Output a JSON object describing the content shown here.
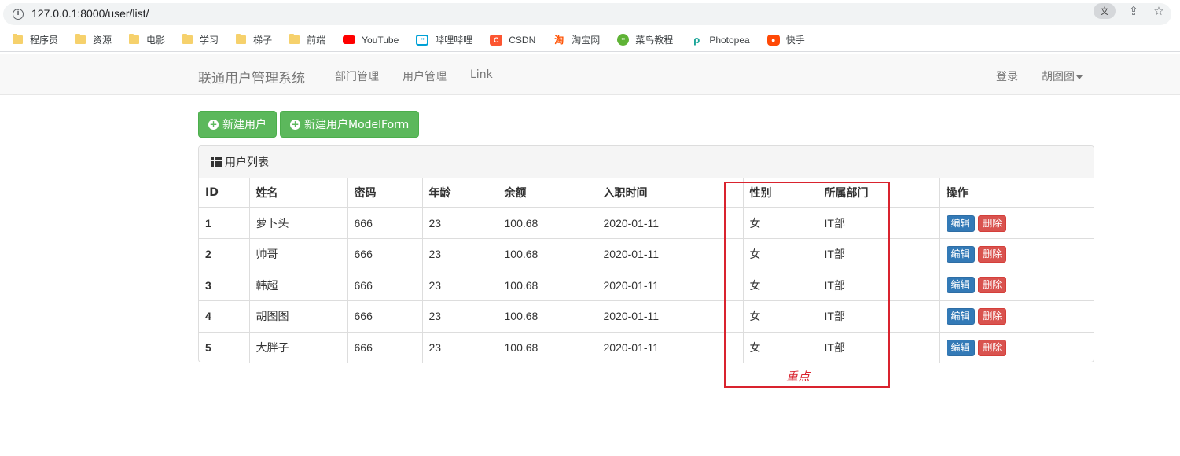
{
  "browser": {
    "url": "127.0.0.1:8000/user/list/",
    "bookmarks": [
      {
        "label": "程序员",
        "icon": "folder-icon"
      },
      {
        "label": "资源",
        "icon": "folder-icon"
      },
      {
        "label": "电影",
        "icon": "folder-icon"
      },
      {
        "label": "学习",
        "icon": "folder-icon"
      },
      {
        "label": "梯子",
        "icon": "folder-icon"
      },
      {
        "label": "前端",
        "icon": "folder-icon"
      },
      {
        "label": "YouTube",
        "icon": "youtube-icon"
      },
      {
        "label": "哔哩哔哩",
        "icon": "bilibili-icon"
      },
      {
        "label": "CSDN",
        "icon": "csdn-icon"
      },
      {
        "label": "淘宝网",
        "icon": "taobao-icon"
      },
      {
        "label": "菜鸟教程",
        "icon": "runoob-icon"
      },
      {
        "label": "Photopea",
        "icon": "photopea-icon"
      },
      {
        "label": "快手",
        "icon": "kuaishou-icon"
      }
    ]
  },
  "navbar": {
    "brand": "联通用户管理系统",
    "links": [
      "部门管理",
      "用户管理",
      "Link"
    ],
    "login": "登录",
    "user": "胡图图"
  },
  "actions": {
    "new_user": "新建用户",
    "new_user_modelform": "新建用户ModelForm"
  },
  "panel": {
    "title": "用户列表",
    "columns": [
      "ID",
      "姓名",
      "密码",
      "年龄",
      "余额",
      "入职时间",
      "性别",
      "所属部门",
      "操作"
    ],
    "rows": [
      {
        "id": "1",
        "name": "萝卜头",
        "password": "666",
        "age": "23",
        "balance": "100.68",
        "date": "2020-01-11",
        "gender": "女",
        "dept": "IT部"
      },
      {
        "id": "2",
        "name": "帅哥",
        "password": "666",
        "age": "23",
        "balance": "100.68",
        "date": "2020-01-11",
        "gender": "女",
        "dept": "IT部"
      },
      {
        "id": "3",
        "name": "韩超",
        "password": "666",
        "age": "23",
        "balance": "100.68",
        "date": "2020-01-11",
        "gender": "女",
        "dept": "IT部"
      },
      {
        "id": "4",
        "name": "胡图图",
        "password": "666",
        "age": "23",
        "balance": "100.68",
        "date": "2020-01-11",
        "gender": "女",
        "dept": "IT部"
      },
      {
        "id": "5",
        "name": "大胖子",
        "password": "666",
        "age": "23",
        "balance": "100.68",
        "date": "2020-01-11",
        "gender": "女",
        "dept": "IT部"
      }
    ],
    "edit_label": "编辑",
    "delete_label": "删除"
  },
  "annotation": {
    "label": "重点",
    "color": "#d9232e"
  }
}
